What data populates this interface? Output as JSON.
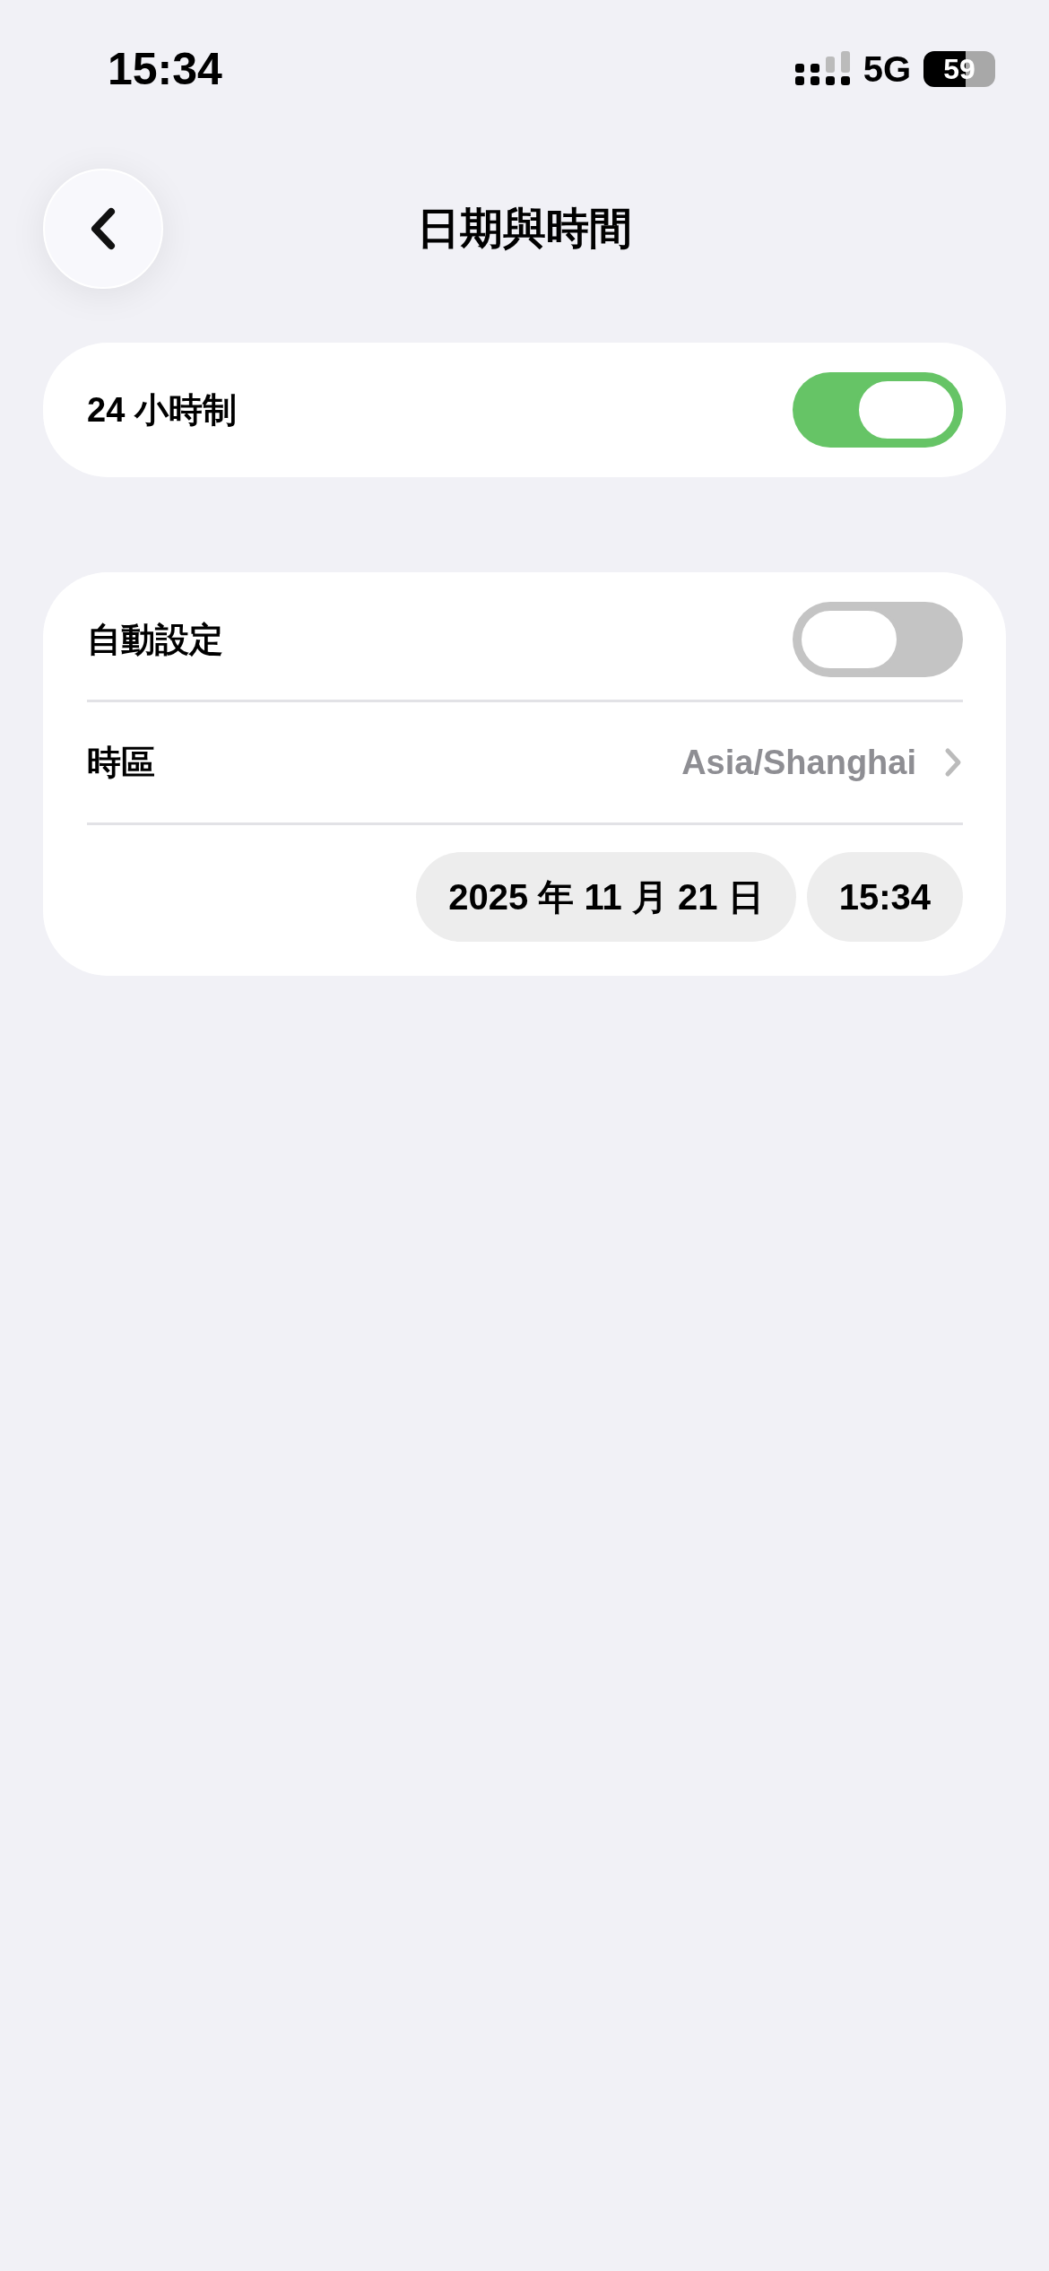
{
  "status_bar": {
    "time": "15:34",
    "network": "5G",
    "battery": "59"
  },
  "nav": {
    "title": "日期與時間"
  },
  "groups": [
    {
      "rows": [
        {
          "kind": "toggle",
          "label": "24 小時制",
          "on": true
        }
      ]
    },
    {
      "rows": [
        {
          "kind": "toggle",
          "label": "自動設定",
          "on": false
        },
        {
          "kind": "link",
          "label": "時區",
          "value": "Asia/Shanghai"
        },
        {
          "kind": "pickers",
          "date": "2025 年 11 月 21 日",
          "time": "15:34"
        }
      ]
    }
  ]
}
